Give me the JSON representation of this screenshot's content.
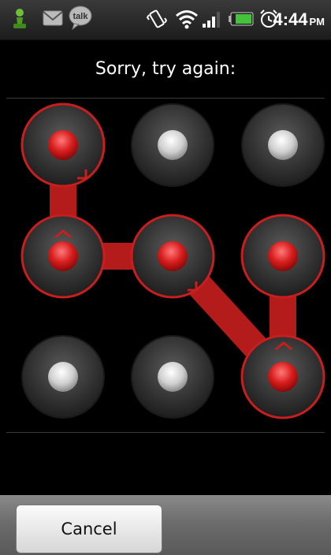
{
  "status_bar": {
    "talk_label": "talk",
    "time": "4:44",
    "ampm": "PM"
  },
  "lock_screen": {
    "prompt": "Sorry, try again:",
    "cancel_label": "Cancel",
    "pattern_sequence": [
      1,
      4,
      5,
      9,
      6
    ],
    "error_color": "#c81e1e",
    "dot_inactive_color": "#d0d0d0"
  },
  "icons": [
    "chess-pawn-notification-icon",
    "gmail-icon",
    "talk-icon",
    "vibrate-icon",
    "wifi-icon",
    "signal-icon",
    "battery-icon",
    "alarm-icon"
  ]
}
